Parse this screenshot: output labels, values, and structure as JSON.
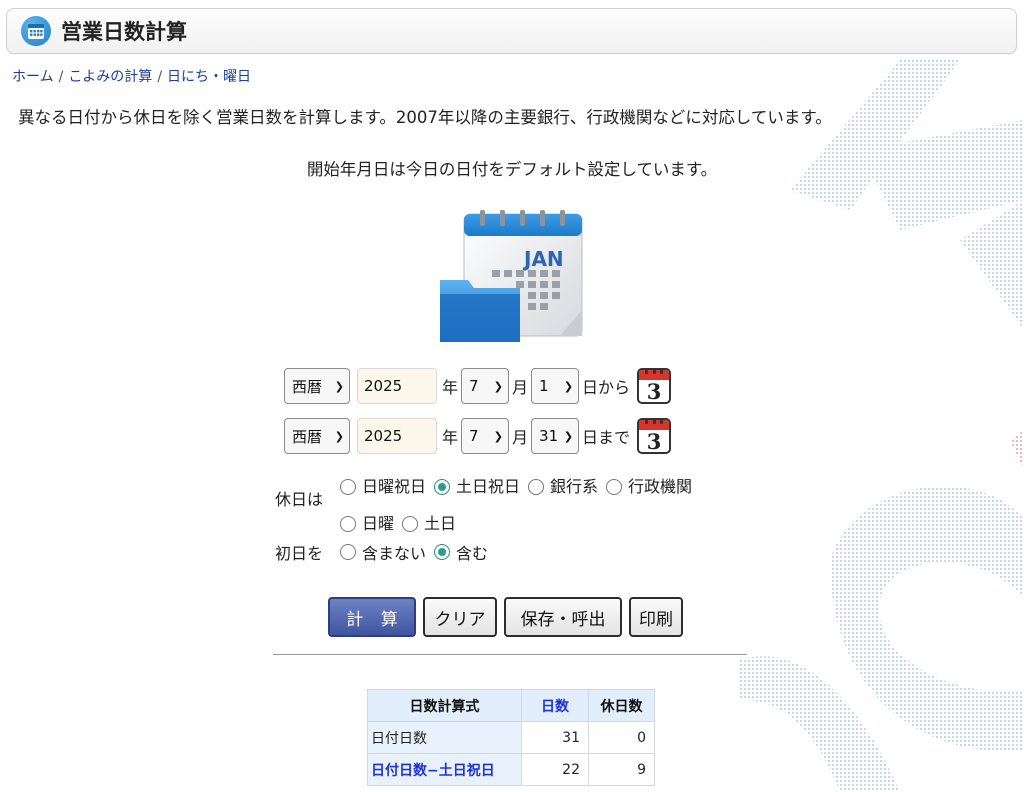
{
  "header": {
    "title": "営業日数計算",
    "icon": "calendar-icon"
  },
  "breadcrumb": [
    {
      "label": "ホーム"
    },
    {
      "label": "こよみの計算"
    },
    {
      "label": "日にち・曜日"
    }
  ],
  "description": "異なる日付から休日を除く営業日数を計算します。2007年以降の主要銀行、行政機関などに対応しています。",
  "note": "開始年月日は今日の日付をデフォルト設定しています。",
  "start": {
    "era": "西暦",
    "year": "2025",
    "year_label": "年",
    "month": "7",
    "month_label": "月",
    "day": "1",
    "day_label": "日から",
    "calendar_digit": "3"
  },
  "end": {
    "era": "西暦",
    "year": "2025",
    "year_label": "年",
    "month": "7",
    "month_label": "月",
    "day": "31",
    "day_label": "日まで",
    "calendar_digit": "3"
  },
  "holidays": {
    "label": "休日は",
    "options": [
      "日曜祝日",
      "土日祝日",
      "銀行系",
      "行政機関",
      "日曜",
      "土日"
    ],
    "selected": "土日祝日"
  },
  "first_day": {
    "label": "初日を",
    "options": [
      "含まない",
      "含む"
    ],
    "selected": "含む"
  },
  "buttons": {
    "calculate": "計 算",
    "clear": "クリア",
    "save": "保存・呼出",
    "print": "印刷"
  },
  "result_table": {
    "headers": [
      "日数計算式",
      "日数",
      "休日数"
    ],
    "rows": [
      {
        "formula": "日付日数",
        "days": "31",
        "holidays": "0"
      },
      {
        "formula": "日付日数−土日祝日",
        "days": "22",
        "holidays": "9"
      }
    ]
  },
  "colors": {
    "accent": "#3f559f",
    "link": "#1a3e9a",
    "radio_on": "#2a9d8f",
    "table_header": "#e2eefb",
    "highlight_text": "#1c33d9"
  },
  "illustration": {
    "month_text": "JAN"
  }
}
